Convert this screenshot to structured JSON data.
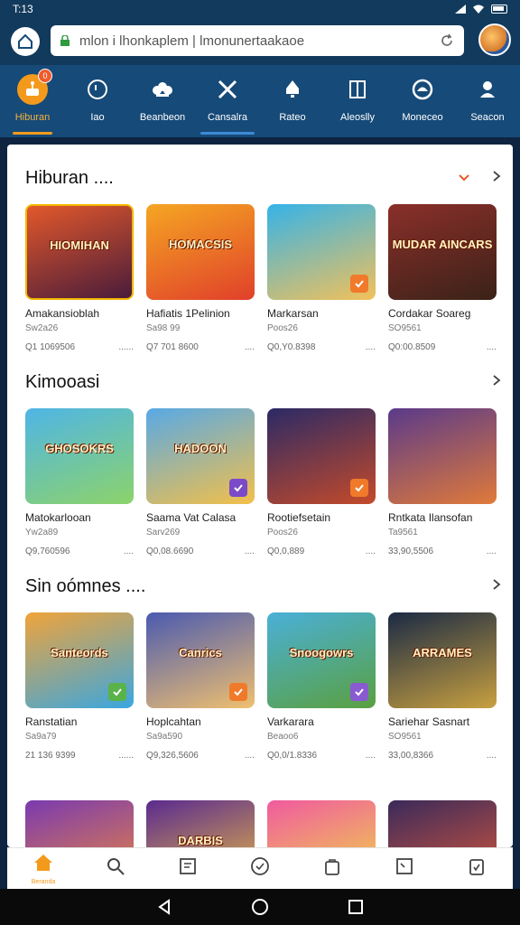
{
  "status_bar": {
    "time": "T:13"
  },
  "browser": {
    "url": "mlon i lhonkaplem | lmonunertaakaoe"
  },
  "categories": [
    {
      "label": "Hiburan",
      "badge": "0",
      "icon": "joystick-icon",
      "active": true
    },
    {
      "label": "Iao",
      "icon": "chat-icon"
    },
    {
      "label": "Beanbeon",
      "icon": "flower-icon"
    },
    {
      "label": "Cansalra",
      "icon": "tools-icon",
      "underline": true
    },
    {
      "label": "Rateo",
      "icon": "bell-icon"
    },
    {
      "label": "Aleoslly",
      "icon": "book-icon"
    },
    {
      "label": "Moneceo",
      "icon": "gamepad-icon"
    },
    {
      "label": "Seacon",
      "icon": "person-icon"
    }
  ],
  "sections": [
    {
      "title": "Hiburan ....",
      "show_dropdown": true,
      "cards": [
        {
          "thumb_text": "HIOMIHAN",
          "title": "Amakansioblah",
          "sub": "Sw2a26",
          "price": "Q1 1069506",
          "rating": "......",
          "colors": [
            "#e2582b",
            "#4a1c3a"
          ]
        },
        {
          "thumb_text": "HOMACSIS",
          "title": "Hafiatis 1Pelinion",
          "sub": "Sa98 99",
          "price": "Q7 701 8600",
          "rating": "....",
          "colors": [
            "#f5a623",
            "#e0402a"
          ]
        },
        {
          "thumb_text": "",
          "title": "Markarsan",
          "sub": "Poos26",
          "price": "Q0,Y0.8398",
          "rating": "....",
          "colors": [
            "#35b3e8",
            "#f2c15a"
          ],
          "badge": "#f07a2a"
        },
        {
          "thumb_text": "MUDAR AINCARS",
          "title": "Cordakar Soareg",
          "sub": "SO9561",
          "price": "Q0:00.8509",
          "rating": "....",
          "colors": [
            "#8b2f2a",
            "#3a2218"
          ]
        }
      ]
    },
    {
      "title": "Kimooasi",
      "show_dropdown": false,
      "cards": [
        {
          "thumb_text": "GHOSOKRS",
          "title": "Matokarlooan",
          "sub": "Yw2a89",
          "price": "Q9,760596",
          "rating": "....",
          "colors": [
            "#4fb5e6",
            "#8cd36a"
          ]
        },
        {
          "thumb_text": "HADOON",
          "title": "Saama Vat Calasa",
          "sub": "Sarv269",
          "price": "Q0,08.6690",
          "rating": "....",
          "colors": [
            "#58a9e6",
            "#f3c049"
          ],
          "badge": "#7a4ac8"
        },
        {
          "thumb_text": "",
          "title": "Rootiefsetain",
          "sub": "Poos26",
          "price": "Q0,0,889",
          "rating": "....",
          "colors": [
            "#2b2a66",
            "#c44a2a"
          ],
          "badge": "#f07a2a"
        },
        {
          "thumb_text": "",
          "title": "Rntkata Ilansofan",
          "sub": "Ta9561",
          "price": "33,90,5506",
          "rating": "....",
          "colors": [
            "#5a3a8a",
            "#e07a3a"
          ]
        }
      ]
    },
    {
      "title": "Sin oómnes ....",
      "show_dropdown": false,
      "cards": [
        {
          "thumb_text": "Santeords",
          "title": "Ranstatian",
          "sub": "Sa9a79",
          "price": "21 136 9399",
          "rating": "......",
          "colors": [
            "#f0a43a",
            "#3aa6e0"
          ],
          "badge": "#5ab24a"
        },
        {
          "thumb_text": "Canrics",
          "title": "Hoplcahtan",
          "sub": "Sa9a590",
          "price": "Q9,326,5606",
          "rating": "....",
          "colors": [
            "#4a5ab0",
            "#f0c070"
          ],
          "badge": "#f07a2a"
        },
        {
          "thumb_text": "Snoogowrs",
          "title": "Varkarara",
          "sub": "Beaoo6",
          "price": "Q0,0/1.8336",
          "rating": "....",
          "colors": [
            "#4ab0d8",
            "#5aa040"
          ],
          "badge": "#8a5ad0"
        },
        {
          "thumb_text": "ARRAMES",
          "title": "Sariehar Sasnart",
          "sub": "SO9561",
          "price": "33,00,8366",
          "rating": "....",
          "colors": [
            "#1a2a44",
            "#c8a040"
          ]
        }
      ]
    },
    {
      "title": "",
      "show_dropdown": false,
      "cards": [
        {
          "thumb_text": "",
          "title": "",
          "sub": "",
          "price": "",
          "rating": "",
          "colors": [
            "#7a3ab0",
            "#f08a3a"
          ]
        },
        {
          "thumb_text": "DARBIS",
          "title": "",
          "sub": "",
          "price": "",
          "rating": "",
          "colors": [
            "#5a2a90",
            "#f0c040"
          ]
        },
        {
          "thumb_text": "",
          "title": "",
          "sub": "",
          "price": "",
          "rating": "",
          "colors": [
            "#f05aa0",
            "#f0e040"
          ]
        },
        {
          "thumb_text": "",
          "title": "",
          "sub": "",
          "price": "",
          "rating": "",
          "colors": [
            "#3a2a5a",
            "#e05a3a"
          ]
        }
      ]
    }
  ],
  "bottom_nav": [
    {
      "icon": "home-icon",
      "label": "Beranda",
      "active": true
    },
    {
      "icon": "search-icon"
    },
    {
      "icon": "document-icon"
    },
    {
      "icon": "clock-icon"
    },
    {
      "icon": "bag-icon"
    },
    {
      "icon": "window-icon"
    },
    {
      "icon": "clipboard-icon"
    }
  ],
  "accent_color": "#f39a1c"
}
